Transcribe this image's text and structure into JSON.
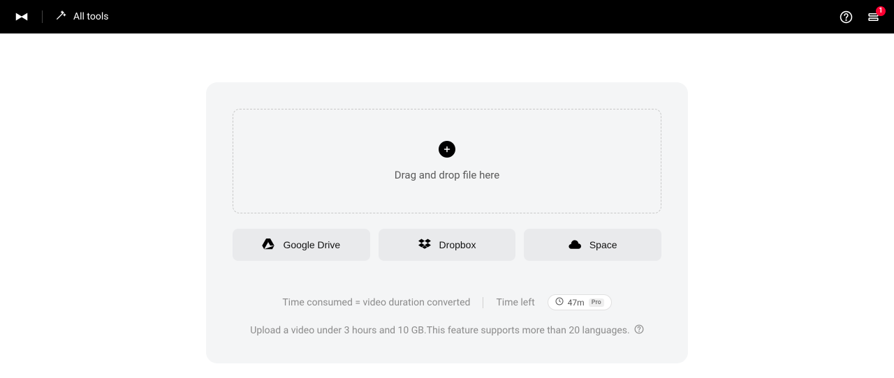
{
  "header": {
    "all_tools_label": "All tools",
    "notification_count": "1"
  },
  "upload": {
    "drop_label": "Drag and drop file here",
    "sources": {
      "google_drive": "Google Drive",
      "dropbox": "Dropbox",
      "space": "Space"
    }
  },
  "info": {
    "time_consumed_label": "Time consumed = video duration converted",
    "time_left_label": "Time left",
    "time_left_value": "47m",
    "pro_tag": "Pro",
    "hint": "Upload a video under 3 hours and 10 GB.This feature supports more than 20 languages."
  }
}
